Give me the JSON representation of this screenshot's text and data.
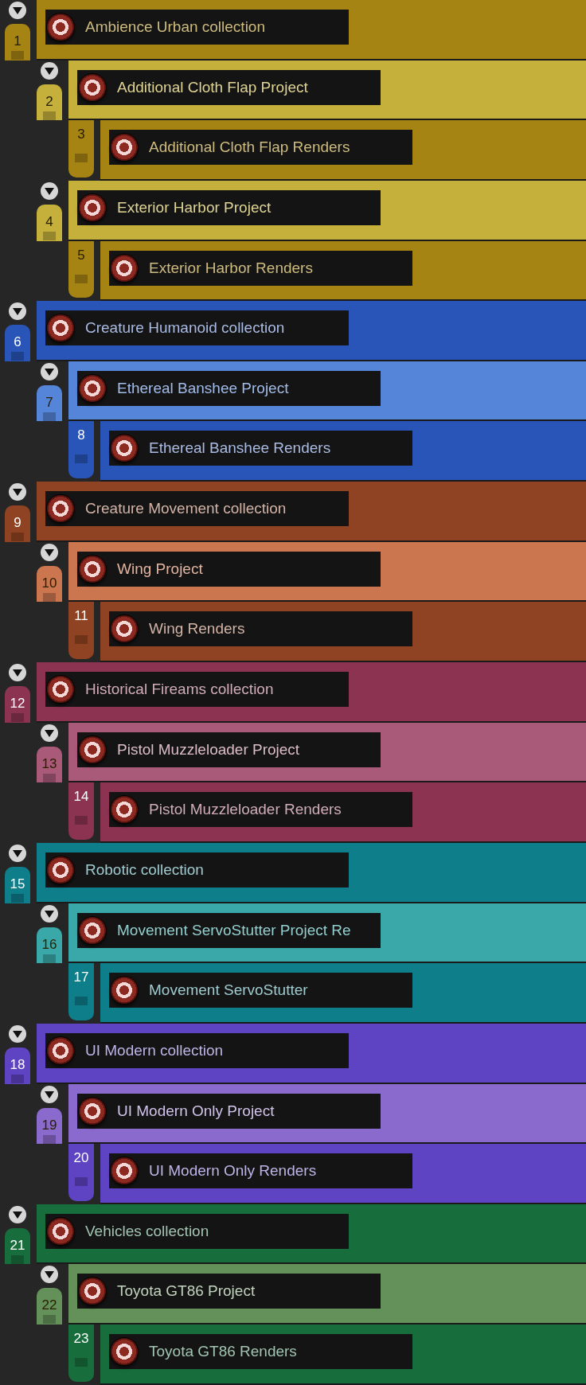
{
  "tracks": [
    {
      "number": "1",
      "name": "Ambience Urban collection",
      "color": "#a58414",
      "expanded": true,
      "children": [
        {
          "number": "2",
          "name": "Additional Cloth Flap Project",
          "color": "#c4b03a",
          "expanded": true,
          "children": [
            {
              "number": "3",
              "name": "Additional Cloth Flap Renders",
              "color": "#a58414"
            }
          ]
        },
        {
          "number": "4",
          "name": "Exterior Harbor Project",
          "color": "#c4b03a",
          "expanded": true,
          "children": [
            {
              "number": "5",
              "name": "Exterior Harbor Renders",
              "color": "#a58414"
            }
          ]
        }
      ]
    },
    {
      "number": "6",
      "name": "Creature Humanoid collection",
      "color": "#2a55b8",
      "expanded": true,
      "children": [
        {
          "number": "7",
          "name": "Ethereal Banshee Project",
          "color": "#5585d8",
          "expanded": true,
          "children": [
            {
              "number": "8",
              "name": "Ethereal Banshee Renders",
              "color": "#2a55b8"
            }
          ]
        }
      ]
    },
    {
      "number": "9",
      "name": "Creature Movement collection",
      "color": "#904322",
      "expanded": true,
      "children": [
        {
          "number": "10",
          "name": "Wing Project",
          "color": "#cc7650",
          "expanded": true,
          "children": [
            {
              "number": "11",
              "name": "Wing Renders",
              "color": "#904322"
            }
          ]
        }
      ]
    },
    {
      "number": "12",
      "name": "Historical Fireams collection",
      "color": "#8b3350",
      "expanded": true,
      "children": [
        {
          "number": "13",
          "name": "Pistol Muzzleloader Project",
          "color": "#a85a78",
          "expanded": true,
          "children": [
            {
              "number": "14",
              "name": "Pistol Muzzleloader Renders",
              "color": "#8b3350"
            }
          ]
        }
      ]
    },
    {
      "number": "15",
      "name": "Robotic collection",
      "color": "#0e7e8a",
      "expanded": true,
      "children": [
        {
          "number": "16",
          "name": "Movement ServoStutter Project Re",
          "color": "#3aa8a8",
          "expanded": true,
          "children": [
            {
              "number": "17",
              "name": "Movement ServoStutter",
              "color": "#0e7e8a"
            }
          ]
        }
      ]
    },
    {
      "number": "18",
      "name": "UI Modern collection",
      "color": "#5e44c2",
      "expanded": true,
      "children": [
        {
          "number": "19",
          "name": "UI Modern Only Project",
          "color": "#8a6acc",
          "expanded": true,
          "children": [
            {
              "number": "20",
              "name": "UI Modern Only Renders",
              "color": "#5e44c2"
            }
          ]
        }
      ]
    },
    {
      "number": "21",
      "name": "Vehicles collection",
      "color": "#176e3c",
      "expanded": true,
      "children": [
        {
          "number": "22",
          "name": "Toyota GT86 Project",
          "color": "#64905a",
          "expanded": true,
          "children": [
            {
              "number": "23",
              "name": "Toyota GT86 Renders",
              "color": "#176e3c"
            }
          ]
        }
      ]
    }
  ]
}
